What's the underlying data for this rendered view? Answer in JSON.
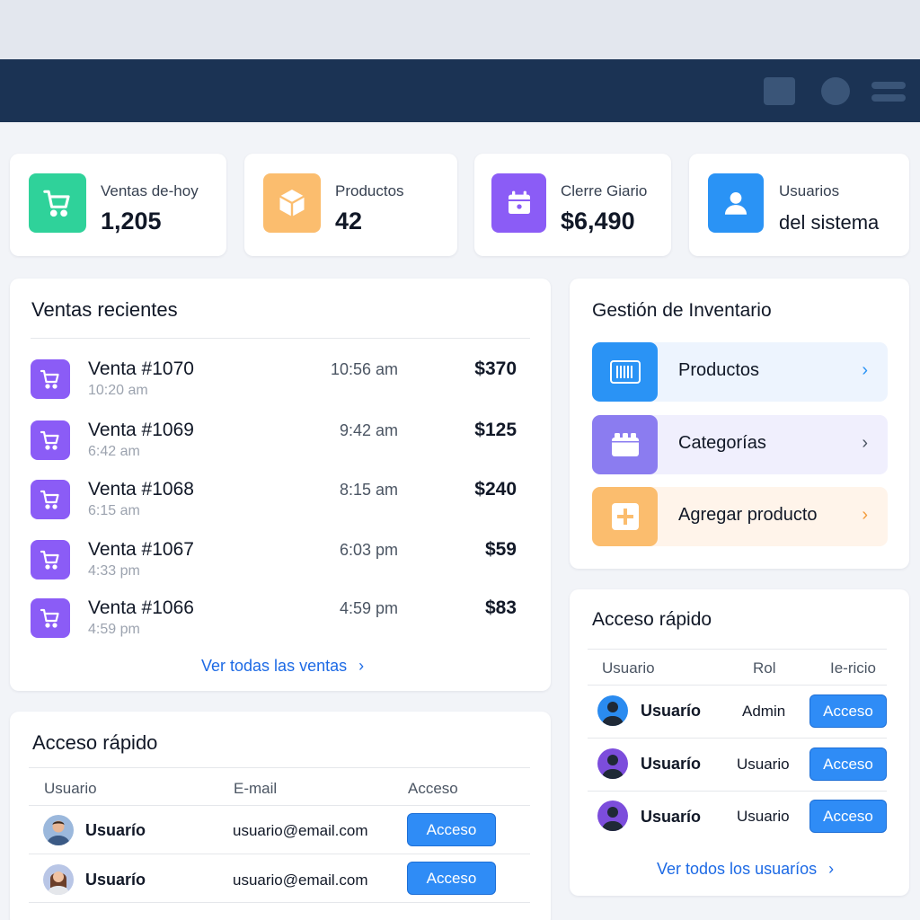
{
  "colors": {
    "navbar": "#1b3354",
    "accent": "#2f8cf6",
    "green": "#2fd29a",
    "orange": "#fbbd6e",
    "purple": "#8b5cf6",
    "blue": "#2a93f5"
  },
  "stats": [
    {
      "label": "Ventas de-hoy",
      "value": "1,205",
      "icon": "shopping-cart-icon"
    },
    {
      "label": "Productos",
      "value": "42",
      "icon": "box-icon"
    },
    {
      "label": "Clerre Giario",
      "value": "$6,490",
      "icon": "calendar-icon"
    },
    {
      "label": "Usuarios",
      "value": "del sistema",
      "icon": "user-icon"
    }
  ],
  "recent_sales": {
    "title": "Ventas recientes",
    "items": [
      {
        "name": "Venta #1070",
        "sub": "10:20 am",
        "time": "10:56 am",
        "amount": "$370"
      },
      {
        "name": "Venta #1069",
        "sub": "6:42 am",
        "time": "9:42 am",
        "amount": "$125"
      },
      {
        "name": "Venta #1068",
        "sub": "6:15 am",
        "time": "8:15 am",
        "amount": "$240"
      },
      {
        "name": "Venta #1067",
        "sub": "4:33 pm",
        "time": "6:03 pm",
        "amount": "$59"
      },
      {
        "name": "Venta #1066",
        "sub": "4:59 pm",
        "time": "4:59 pm",
        "amount": "$83"
      }
    ],
    "view_all": "Ver todas las ventas"
  },
  "inventory": {
    "title": "Gestión de Inventario",
    "items": [
      {
        "label": "Productos",
        "icon": "barcode-icon"
      },
      {
        "label": "Categorías",
        "icon": "folder-icon"
      },
      {
        "label": "Agregar producto",
        "icon": "plus-icon"
      }
    ]
  },
  "quick_access_left": {
    "title": "Acceso rápido",
    "headers": [
      "Usuario",
      "E-mail",
      "Acceso"
    ],
    "rows": [
      {
        "name": "Usuarío",
        "email": "usuario@email.com",
        "button": "Acceso"
      },
      {
        "name": "Usuarío",
        "email": "usuario@email.com",
        "button": "Acceso"
      }
    ]
  },
  "quick_access_right": {
    "title": "Acceso rápido",
    "headers": [
      "Usuario",
      "Rol",
      "Ie-ricio"
    ],
    "rows": [
      {
        "name": "Usuarío",
        "role": "Admin",
        "button": "Acceso"
      },
      {
        "name": "Usuarío",
        "role": "Usuario",
        "button": "Acceso"
      },
      {
        "name": "Usuarío",
        "role": "Usuario",
        "button": "Acceso"
      }
    ],
    "view_all": "Ver todos los usuaríos"
  }
}
